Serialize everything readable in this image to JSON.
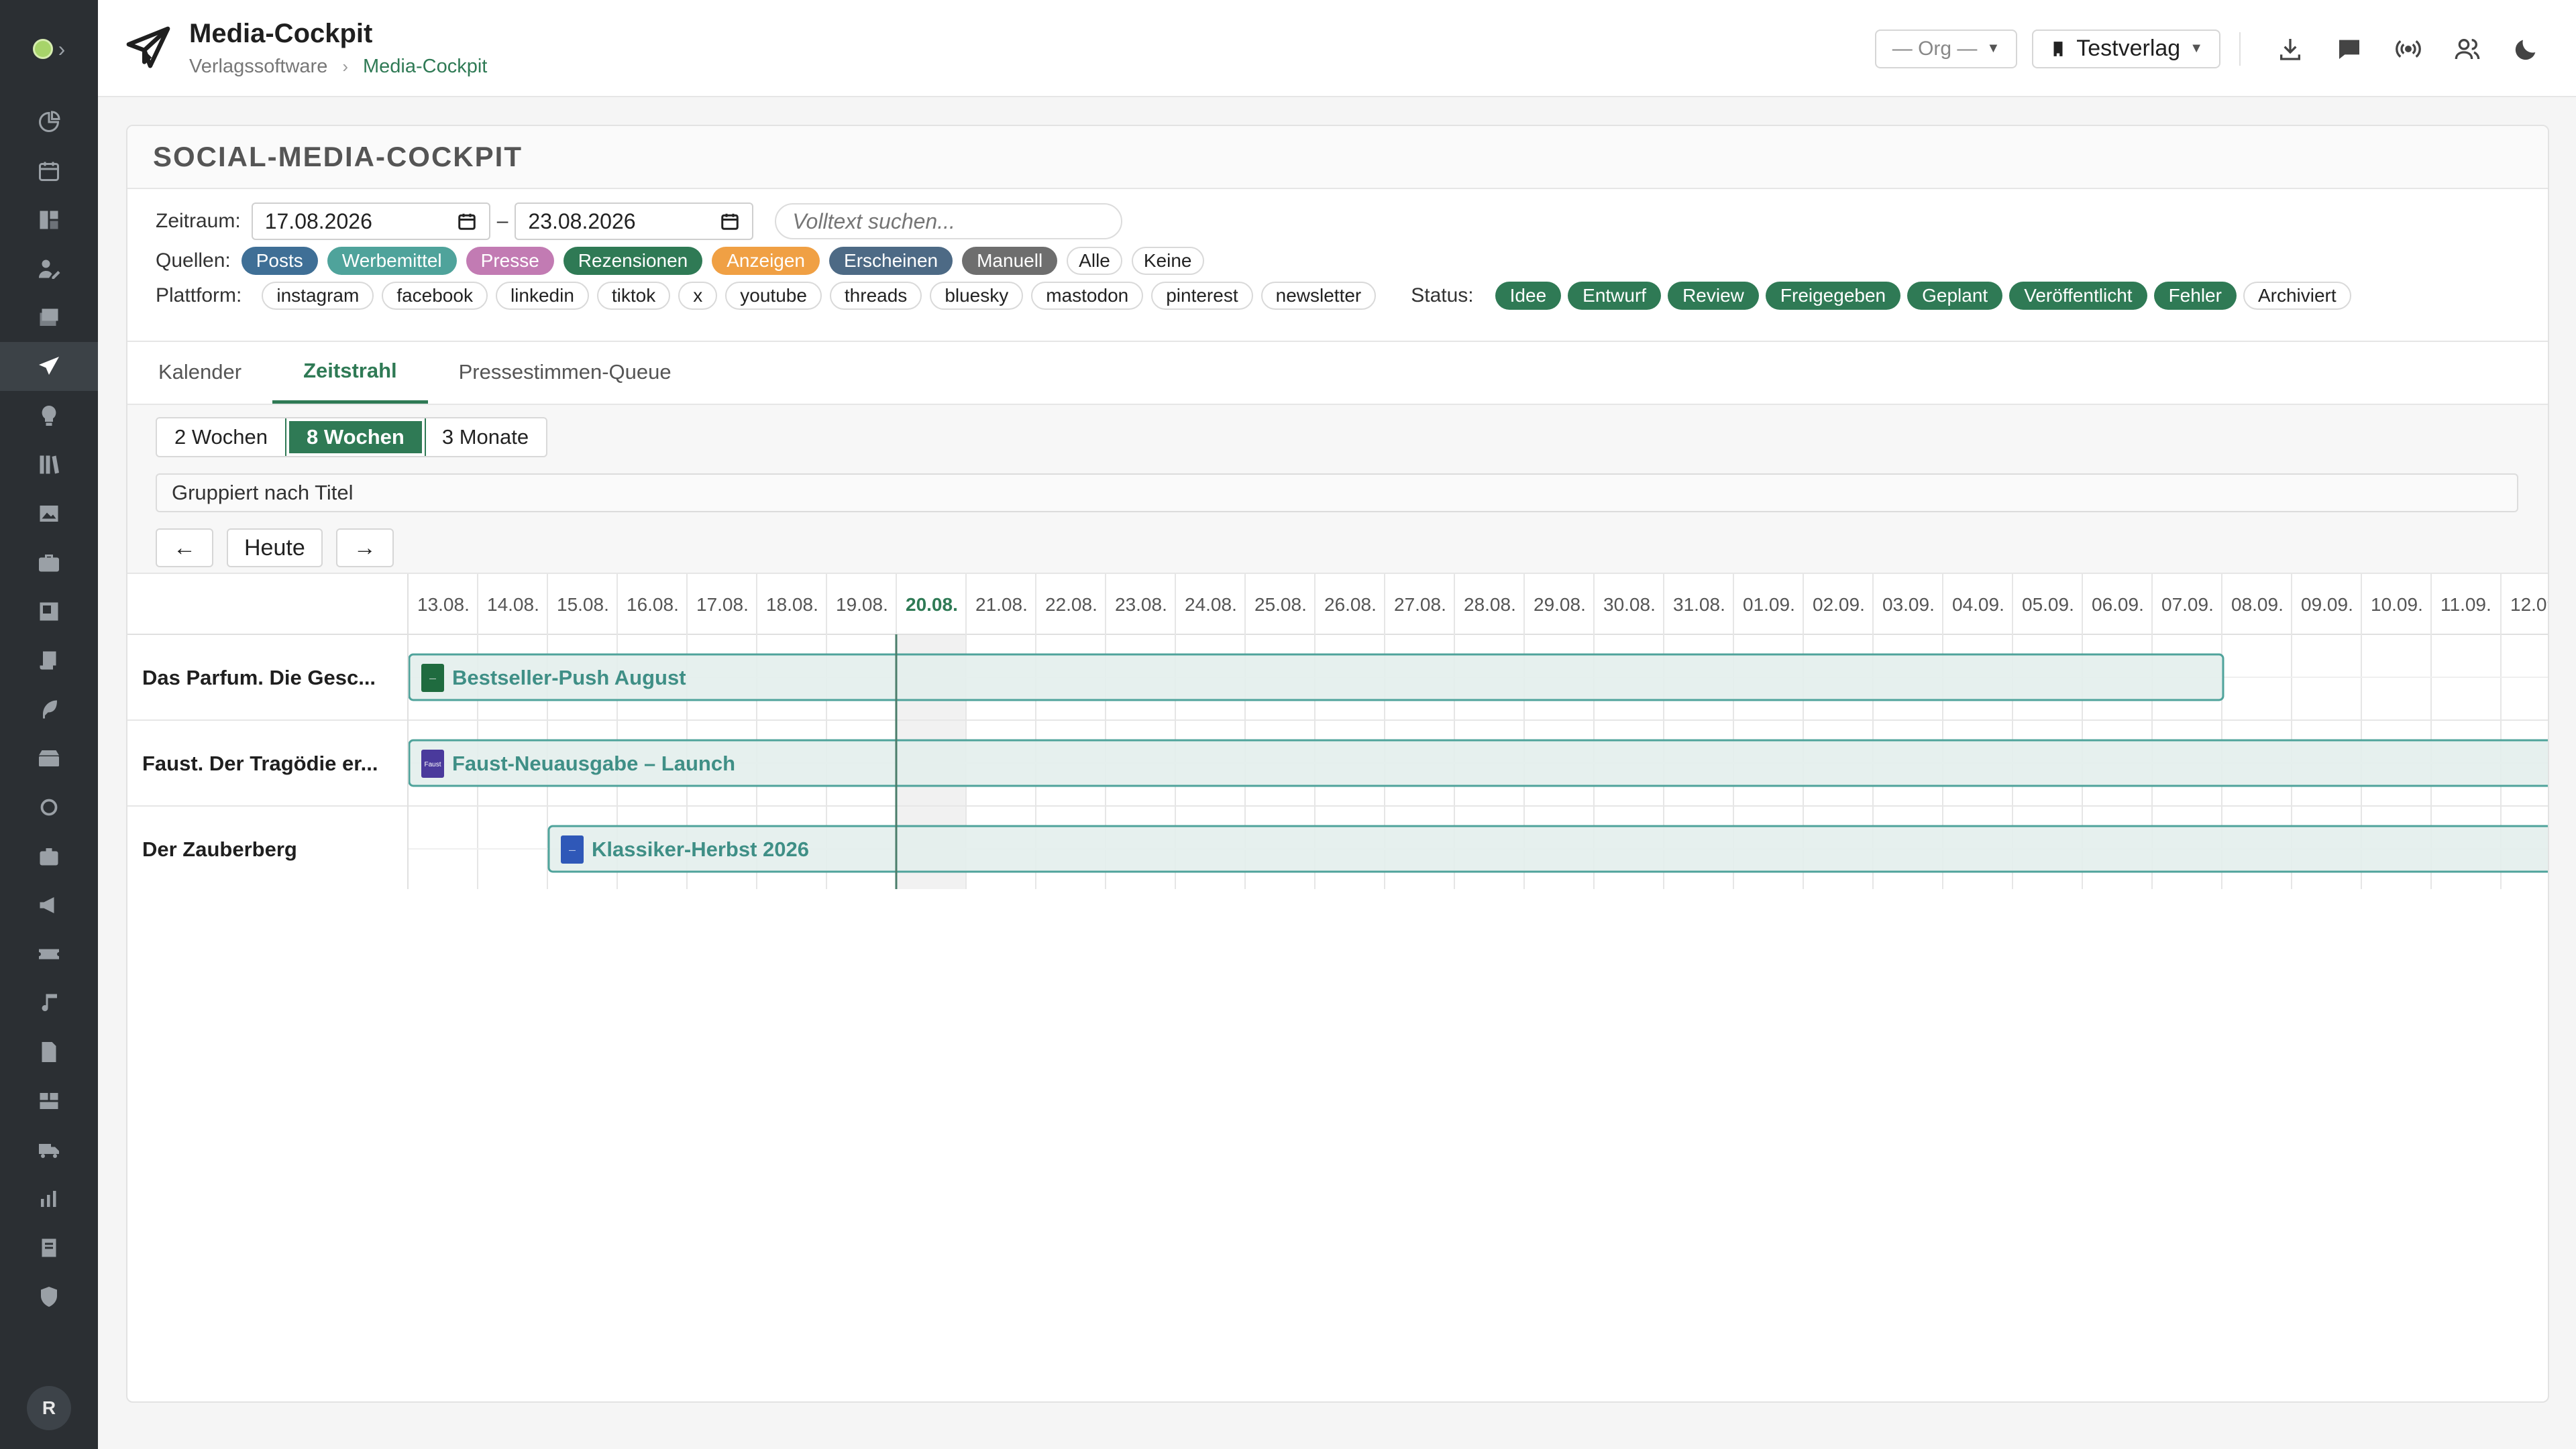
{
  "app": {
    "title": "Media-Cockpit",
    "breadcrumb": [
      "Verlagssoftware",
      "Media-Cockpit"
    ]
  },
  "header": {
    "org_select": "— Org —",
    "publisher_select": "Testverlag",
    "avatar_initial": "R"
  },
  "card": {
    "title": "SOCIAL-MEDIA-COCKPIT"
  },
  "filters": {
    "period_label": "Zeitraum:",
    "date_from": "17.08.2026",
    "date_dash": "–",
    "date_to": "23.08.2026",
    "search_placeholder": "Volltext suchen...",
    "sources_label": "Quellen:",
    "sources": [
      {
        "label": "Posts",
        "color": "#3f6f96"
      },
      {
        "label": "Werbemittel",
        "color": "#4fa39b"
      },
      {
        "label": "Presse",
        "color": "#c27bb3"
      },
      {
        "label": "Rezensionen",
        "color": "#2f7a55"
      },
      {
        "label": "Anzeigen",
        "color": "#f0a044"
      },
      {
        "label": "Erscheinen",
        "color": "#4d6a85"
      },
      {
        "label": "Manuell",
        "color": "#6e6e6e"
      }
    ],
    "sources_all": "Alle",
    "sources_none": "Keine",
    "platform_label": "Plattform:",
    "platforms": [
      "instagram",
      "facebook",
      "linkedin",
      "tiktok",
      "x",
      "youtube",
      "threads",
      "bluesky",
      "mastodon",
      "pinterest",
      "newsletter"
    ],
    "status_label": "Status:",
    "statuses": [
      "Idee",
      "Entwurf",
      "Review",
      "Freigegeben",
      "Geplant",
      "Veröffentlicht",
      "Fehler"
    ],
    "status_archived": "Archiviert"
  },
  "tabs": [
    "Kalender",
    "Zeitstrahl",
    "Pressestimmen-Queue"
  ],
  "toolbar": {
    "ranges": [
      "2 Wochen",
      "8 Wochen",
      "3 Monate"
    ],
    "grouped": "Gruppiert nach Titel",
    "prev": "←",
    "today": "Heute",
    "next": "→"
  },
  "timeline": {
    "dates": [
      "13.08.",
      "14.08.",
      "15.08.",
      "16.08.",
      "17.08.",
      "18.08.",
      "19.08.",
      "20.08.",
      "21.08.",
      "22.08.",
      "23.08.",
      "24.08.",
      "25.08.",
      "26.08.",
      "27.08.",
      "28.08.",
      "29.08.",
      "30.08.",
      "31.08.",
      "01.09.",
      "02.09.",
      "03.09.",
      "04.09.",
      "05.09.",
      "06.09.",
      "07.09.",
      "08.09.",
      "09.09.",
      "10.09.",
      "11.09.",
      "12.09."
    ],
    "today_index": 7,
    "rows": [
      {
        "title": "Das Parfum. Die Gesc...",
        "bar": "Bestseller-Push August",
        "start": 0,
        "end": 26,
        "thumb": "#1f6b3f",
        "thumb_text": "—"
      },
      {
        "title": "Faust. Der Tragödie er...",
        "bar": "Faust-Neuausgabe – Launch",
        "start": 0,
        "end": 40,
        "thumb": "#4a3a9c",
        "thumb_text": "Faust"
      },
      {
        "title": "Der Zauberberg",
        "bar": "Klassiker-Herbst 2026",
        "start": 2,
        "end": 40,
        "thumb": "#2f58b8",
        "thumb_text": "—"
      }
    ]
  }
}
